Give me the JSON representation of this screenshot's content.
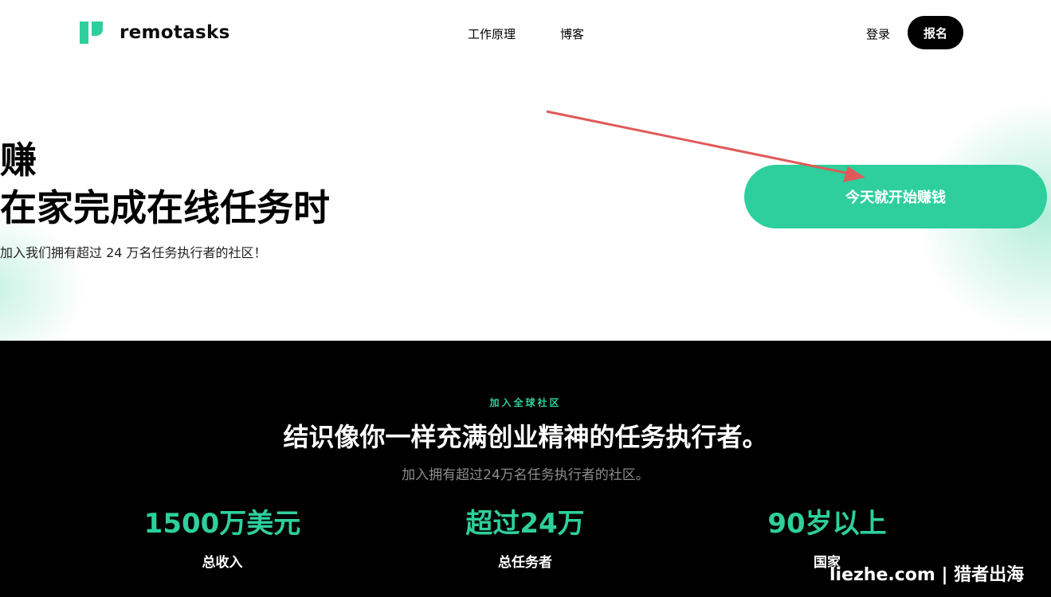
{
  "header": {
    "brand": "remotasks",
    "nav": [
      "工作原理",
      "博客"
    ],
    "login_label": "登录",
    "signup_label": "报名"
  },
  "hero": {
    "line1": "赚",
    "line2": "在家完成在线任务时",
    "subtitle": "加入我们拥有超过 24 万名任务执行者的社区！",
    "cta_label": "今天就开始赚钱"
  },
  "community": {
    "eyebrow": "加入全球社区",
    "title": "结识像你一样充满创业精神的任务执行者。",
    "subtitle": "加入拥有超过24万名任务执行者的社区。",
    "stats": [
      {
        "value": "1500万美元",
        "label": "总收入"
      },
      {
        "value": "超过24万",
        "label": "总任务者"
      },
      {
        "value": "90岁以上",
        "label": "国家"
      }
    ]
  },
  "watermark": "liezhe.com | 猎者出海",
  "colors": {
    "accent": "#2ecf9c",
    "annotation_arrow": "#e05a5a",
    "dark_bg": "#000000"
  }
}
